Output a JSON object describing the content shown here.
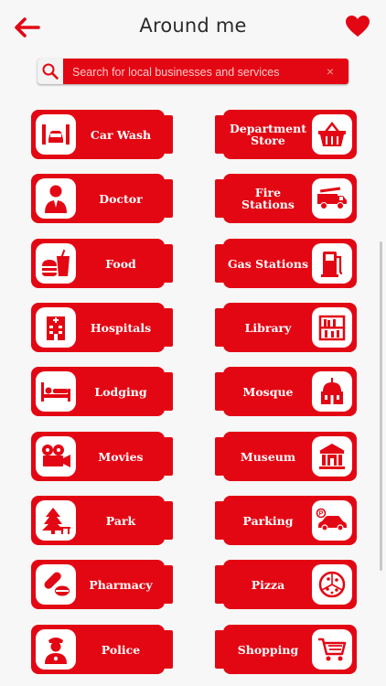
{
  "header": {
    "title": "Around me",
    "back_icon": "back-arrow-icon",
    "favorite_icon": "heart-icon"
  },
  "search": {
    "placeholder": "Search for local businesses and services",
    "value": "",
    "clear_label": "×"
  },
  "colors": {
    "accent": "#e30613",
    "background": "#f7f7f7",
    "icon_bg": "#ffffff"
  },
  "categories": {
    "left": [
      {
        "label": "Car Wash",
        "icon": "car-wash-icon"
      },
      {
        "label": "Doctor",
        "icon": "doctor-icon"
      },
      {
        "label": "Food",
        "icon": "food-icon"
      },
      {
        "label": "Hospitals",
        "icon": "hospital-icon"
      },
      {
        "label": "Lodging",
        "icon": "bed-icon"
      },
      {
        "label": "Movies",
        "icon": "movie-camera-icon"
      },
      {
        "label": "Park",
        "icon": "tree-icon"
      },
      {
        "label": "Pharmacy",
        "icon": "pills-icon"
      },
      {
        "label": "Police",
        "icon": "police-icon"
      }
    ],
    "right": [
      {
        "label": "Department\nStore",
        "icon": "basket-icon"
      },
      {
        "label": "Fire Stations",
        "icon": "fire-truck-icon"
      },
      {
        "label": "Gas Stations",
        "icon": "gas-pump-icon"
      },
      {
        "label": "Library",
        "icon": "bookshelf-icon"
      },
      {
        "label": "Mosque",
        "icon": "mosque-icon"
      },
      {
        "label": "Museum",
        "icon": "museum-icon"
      },
      {
        "label": "Parking",
        "icon": "parking-car-icon"
      },
      {
        "label": "Pizza",
        "icon": "pizza-icon"
      },
      {
        "label": "Shopping",
        "icon": "shopping-cart-icon"
      }
    ]
  }
}
